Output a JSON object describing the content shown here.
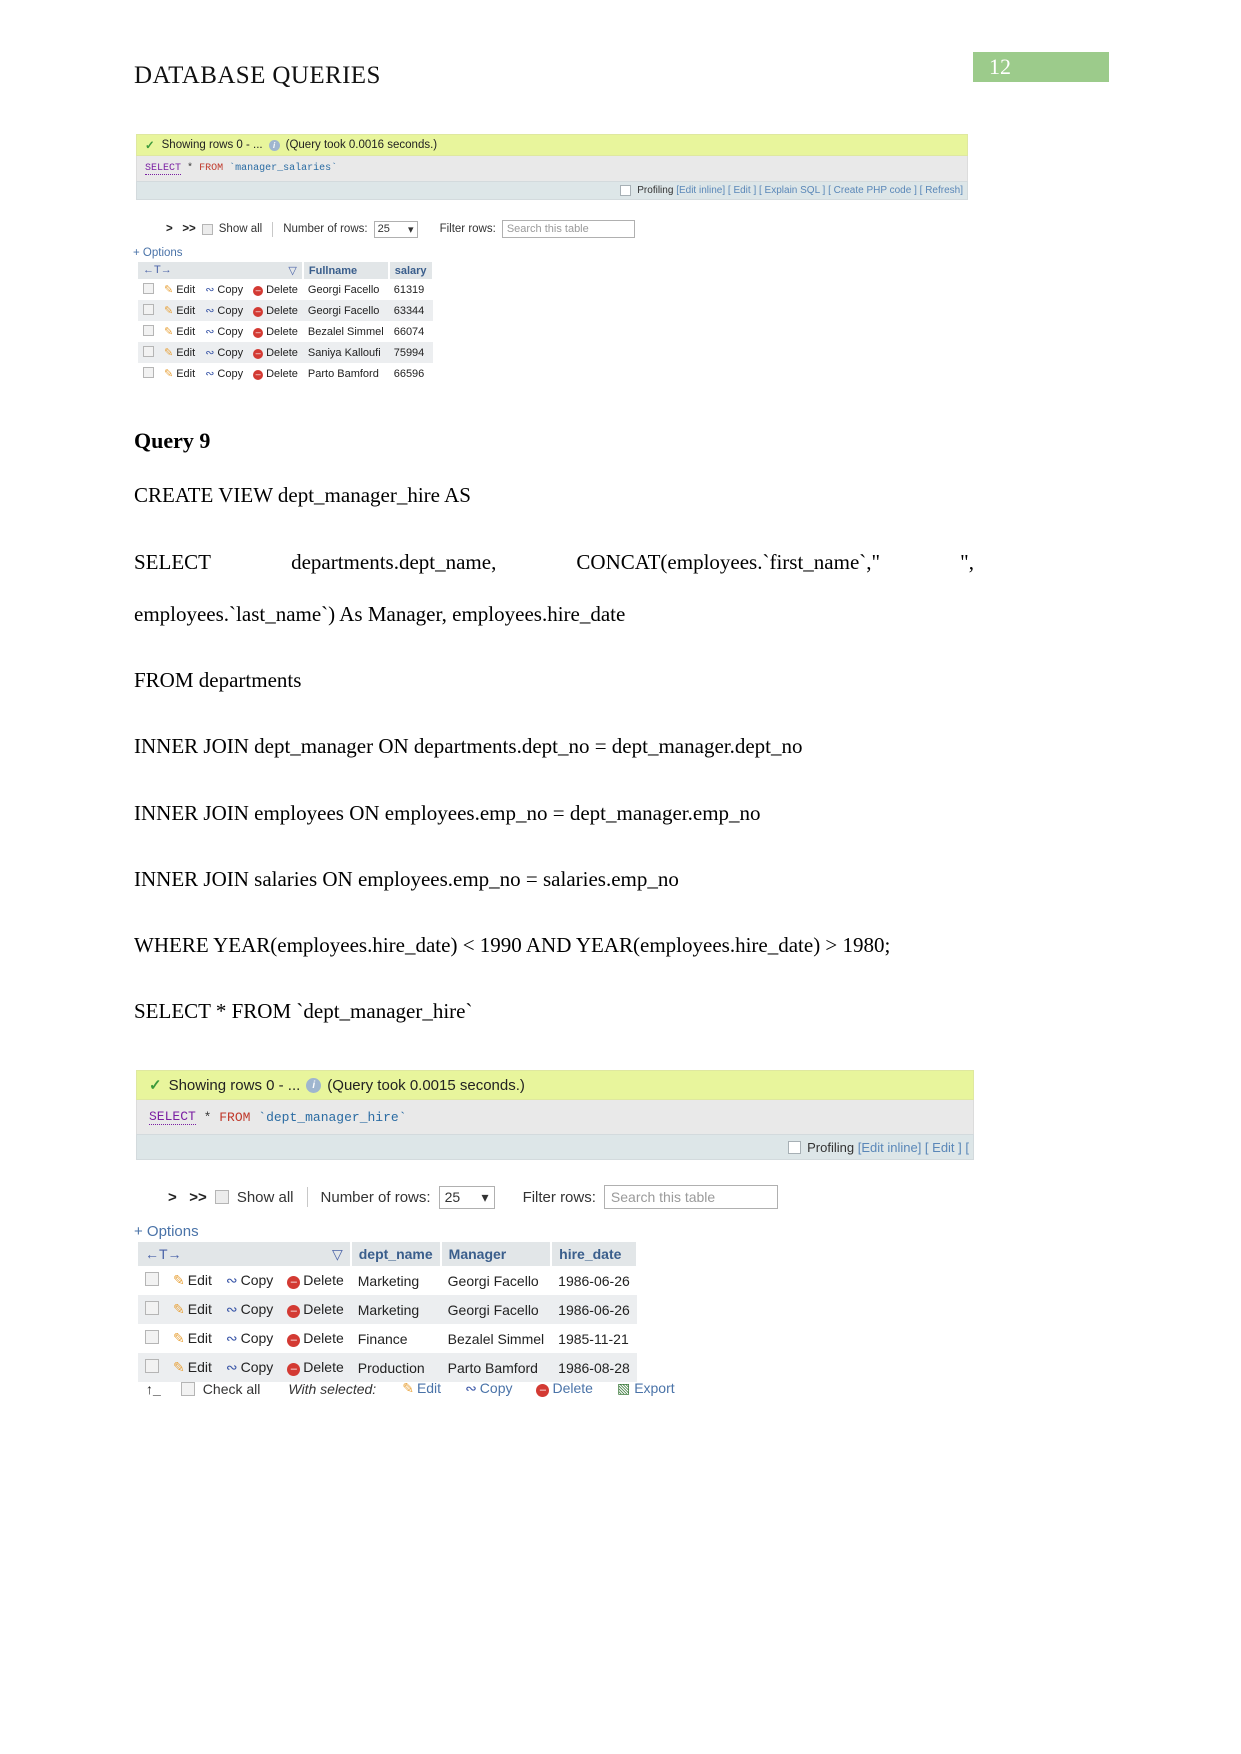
{
  "header": {
    "title": "DATABASE QUERIES",
    "page_number": "12"
  },
  "result1": {
    "status": "Showing rows 0 - ...",
    "query_time": "(Query took 0.0016 seconds.)",
    "sql": {
      "select": "SELECT",
      "star": "*",
      "from": "FROM",
      "table": "`manager_salaries`"
    },
    "profiling": {
      "label": "Profiling",
      "links": "[Edit inline] [ Edit ] [ Explain SQL ] [ Create PHP code ] [ Refresh]"
    },
    "nav": {
      "next": ">",
      "last": ">>",
      "show_all": "Show all",
      "rows_label": "Number of rows:",
      "rows_value": "25",
      "caret": "▾",
      "filter_label": "Filter rows:",
      "filter_placeholder": "Search this table"
    },
    "options_label": "+ Options",
    "sort_icon": "←T→",
    "sort_caret": "▽",
    "actions": {
      "edit": "Edit",
      "copy": "Copy",
      "delete": "Delete"
    },
    "columns": [
      "Fullname",
      "salary"
    ],
    "rows": [
      {
        "fullname": "Georgi Facello",
        "salary": "61319"
      },
      {
        "fullname": "Georgi Facello",
        "salary": "63344"
      },
      {
        "fullname": "Bezalel Simmel",
        "salary": "66074"
      },
      {
        "fullname": "Saniya Kalloufi",
        "salary": "75994"
      },
      {
        "fullname": "Parto Bamford",
        "salary": "66596"
      }
    ]
  },
  "query9": {
    "heading": "Query 9",
    "lines": [
      "CREATE VIEW dept_manager_hire AS",
      "employees.`last_name`) As Manager, employees.hire_date",
      "FROM departments",
      "INNER JOIN dept_manager ON departments.dept_no = dept_manager.dept_no",
      "INNER JOIN employees ON employees.emp_no = dept_manager.emp_no",
      "INNER JOIN salaries ON employees.emp_no = salaries.emp_no",
      "WHERE YEAR(employees.hire_date) < 1990 AND YEAR(employees.hire_date) > 1980;",
      "SELECT * FROM `dept_manager_hire`"
    ],
    "select_line": {
      "a": "SELECT",
      "b": "departments.dept_name,",
      "c": "CONCAT(employees.`first_name`,\"",
      "d": "\","
    }
  },
  "result2": {
    "status": "Showing rows 0 - ...",
    "query_time": "(Query took 0.0015 seconds.)",
    "sql": {
      "select": "SELECT",
      "star": "*",
      "from": "FROM",
      "table": "`dept_manager_hire`"
    },
    "profiling": {
      "label": "Profiling",
      "links": "[Edit inline] [ Edit ] ["
    },
    "nav": {
      "next": ">",
      "last": ">>",
      "show_all": "Show all",
      "rows_label": "Number of rows:",
      "rows_value": "25",
      "caret": "▾",
      "filter_label": "Filter rows:",
      "filter_placeholder": "Search this table"
    },
    "options_label": "+ Options",
    "sort_icon": "←T→",
    "sort_caret": "▽",
    "actions": {
      "edit": "Edit",
      "copy": "Copy",
      "delete": "Delete"
    },
    "columns": [
      "dept_name",
      "Manager",
      "hire_date"
    ],
    "rows": [
      {
        "dept_name": "Marketing",
        "manager": "Georgi Facello",
        "hire_date": "1986-06-26"
      },
      {
        "dept_name": "Marketing",
        "manager": "Georgi Facello",
        "hire_date": "1986-06-26"
      },
      {
        "dept_name": "Finance",
        "manager": "Bezalel Simmel",
        "hire_date": "1985-11-21"
      },
      {
        "dept_name": "Production",
        "manager": "Parto Bamford",
        "hire_date": "1986-08-28"
      }
    ],
    "footer": {
      "check_all": "Check all",
      "with_selected": "With selected:",
      "edit": "Edit",
      "copy": "Copy",
      "delete": "Delete",
      "export": "Export"
    }
  },
  "colors": {
    "badge_green": "#9ccb8b",
    "success_yellow": "#e8f59c",
    "link_blue": "#4a73a8",
    "header_blue": "#3a5e8c"
  }
}
